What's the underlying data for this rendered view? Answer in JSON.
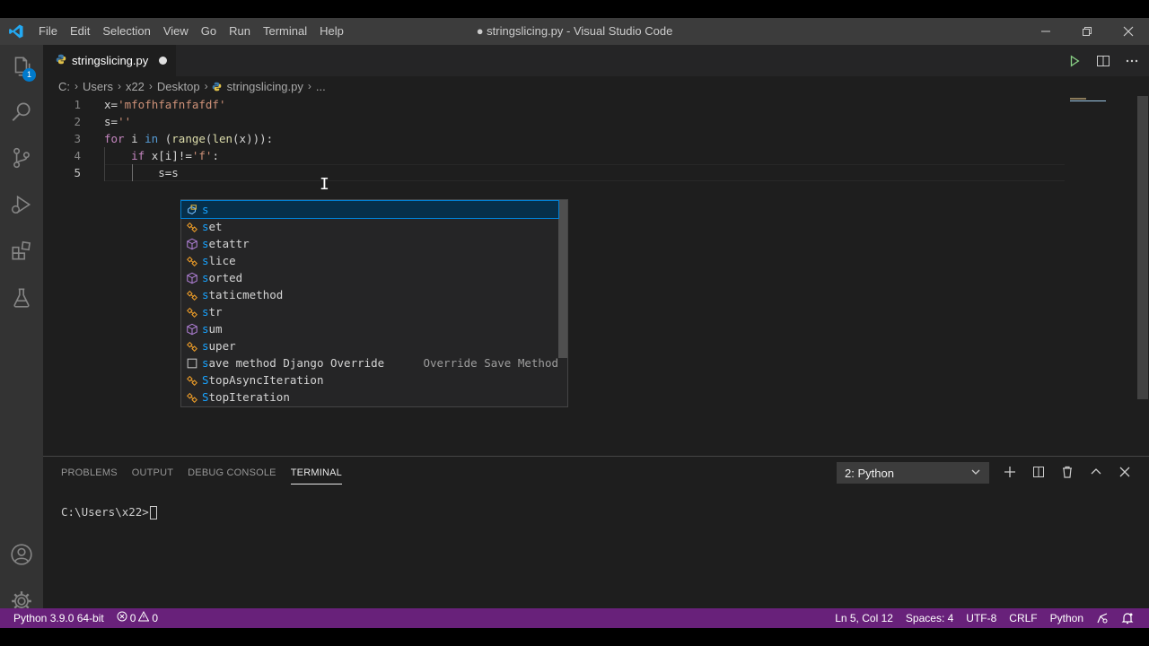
{
  "colors": {
    "accent": "#007acc",
    "status_bar": "#68217a",
    "title_bar": "#3c3c3c",
    "activity_bar": "#333333",
    "editor_bg": "#1e1e1e",
    "suggest_match": "#18a3ff"
  },
  "titlebar": {
    "app_icon": "vscode-logo-icon",
    "menu": [
      "File",
      "Edit",
      "Selection",
      "View",
      "Go",
      "Run",
      "Terminal",
      "Help"
    ],
    "title": "● stringslicing.py - Visual Studio Code",
    "controls": [
      "minimize-icon",
      "restore-icon",
      "close-icon"
    ]
  },
  "activitybar": {
    "items": [
      {
        "icon": "explorer-icon",
        "badge": "1"
      },
      {
        "icon": "search-icon"
      },
      {
        "icon": "source-control-icon"
      },
      {
        "icon": "run-debug-icon"
      },
      {
        "icon": "extensions-icon"
      },
      {
        "icon": "testing-icon"
      }
    ],
    "bottom": [
      {
        "icon": "account-icon"
      },
      {
        "icon": "manage-gear-icon"
      }
    ]
  },
  "tab": {
    "label": "stringslicing.py",
    "dirty": true,
    "icon": "python-file-icon"
  },
  "editor_actions": [
    "run-python-file-icon",
    "split-editor-icon",
    "more-actions-icon"
  ],
  "breadcrumb": [
    "C:",
    "Users",
    "x22",
    "Desktop",
    "stringslicing.py",
    "..."
  ],
  "code": {
    "lines": [
      {
        "n": "1",
        "text": "x='mfofhfafnfafdf'"
      },
      {
        "n": "2",
        "text": "s=''"
      },
      {
        "n": "3",
        "text": "for i in (range(len(x))):"
      },
      {
        "n": "4",
        "text": "    if x[i]!='f':"
      },
      {
        "n": "5",
        "text": "        s=s"
      }
    ],
    "current_line": "5"
  },
  "suggest": {
    "items": [
      {
        "label": "s",
        "kind": "variable-icon"
      },
      {
        "label": "set",
        "kind": "class-icon"
      },
      {
        "label": "setattr",
        "kind": "function-cube-icon"
      },
      {
        "label": "slice",
        "kind": "class-icon"
      },
      {
        "label": "sorted",
        "kind": "function-cube-icon"
      },
      {
        "label": "staticmethod",
        "kind": "class-icon"
      },
      {
        "label": "str",
        "kind": "class-icon"
      },
      {
        "label": "sum",
        "kind": "function-cube-icon"
      },
      {
        "label": "super",
        "kind": "class-icon"
      },
      {
        "label": "save method Django Override",
        "kind": "snippet-icon",
        "detail": "Override Save Method"
      },
      {
        "label": "StopAsyncIteration",
        "kind": "class-icon"
      },
      {
        "label": "StopIteration",
        "kind": "class-icon"
      }
    ],
    "selected_index": 0
  },
  "panel": {
    "tabs": [
      "PROBLEMS",
      "OUTPUT",
      "DEBUG CONSOLE",
      "TERMINAL"
    ],
    "active_tab": "TERMINAL",
    "terminal_select": "2: Python",
    "actions": [
      "new-terminal-icon",
      "split-terminal-icon",
      "kill-terminal-icon",
      "maximize-panel-icon",
      "close-panel-icon"
    ],
    "terminal_prompt": "C:\\Users\\x22>"
  },
  "statusbar": {
    "interpreter": "Python 3.9.0 64-bit",
    "errors": "0",
    "warnings": "0",
    "position": "Ln 5, Col 12",
    "spaces": "Spaces: 4",
    "encoding": "UTF-8",
    "eol": "CRLF",
    "language": "Python"
  }
}
